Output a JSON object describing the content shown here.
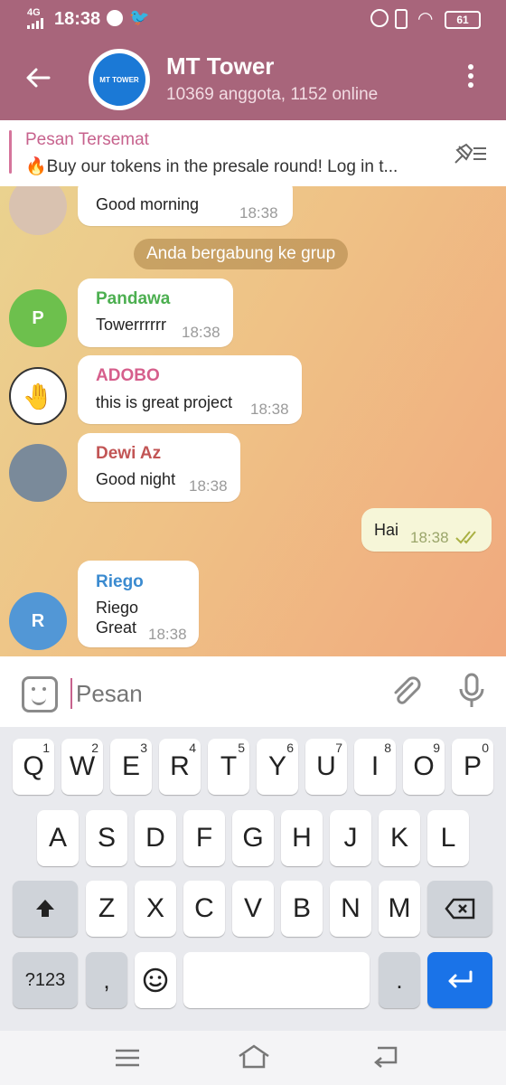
{
  "status": {
    "network": "4G",
    "time": "18:38",
    "battery": "61"
  },
  "header": {
    "title": "MT Tower",
    "subtitle": "10369 anggota, 1152 online",
    "avatar_text": "MT TOWER"
  },
  "pinned": {
    "label": "Pesan Tersemat",
    "text": "🔥Buy our tokens in the presale round! Log in t..."
  },
  "messages": [
    {
      "name": "",
      "text": "Good morning",
      "time": "18:38",
      "name_color": "#c7628d"
    },
    {
      "name": "Pandawa",
      "text": "Towerrrrrr",
      "time": "18:38",
      "name_color": "#4caf50",
      "avatar_letter": "P",
      "avatar_color": "#6dc04d"
    },
    {
      "name": "ADOBO",
      "text": "this is great project",
      "time": "18:38",
      "name_color": "#d65f8c"
    },
    {
      "name": "Dewi Az",
      "text": "Good night",
      "time": "18:38",
      "name_color": "#c25555"
    },
    {
      "name": "",
      "text": "Hai",
      "time": "18:38"
    },
    {
      "name": "Riego",
      "text_line1": "Riego",
      "text_line2": "Great",
      "time": "18:38",
      "name_color": "#3b8bd0",
      "avatar_letter": "R",
      "avatar_color": "#5297d6"
    }
  ],
  "service_message": "Anda bergabung ke grup",
  "input": {
    "placeholder": "Pesan"
  },
  "keyboard": {
    "row1": [
      {
        "k": "Q",
        "n": "1"
      },
      {
        "k": "W",
        "n": "2"
      },
      {
        "k": "E",
        "n": "3"
      },
      {
        "k": "R",
        "n": "4"
      },
      {
        "k": "T",
        "n": "5"
      },
      {
        "k": "Y",
        "n": "6"
      },
      {
        "k": "U",
        "n": "7"
      },
      {
        "k": "I",
        "n": "8"
      },
      {
        "k": "O",
        "n": "9"
      },
      {
        "k": "P",
        "n": "0"
      }
    ],
    "row2": [
      "A",
      "S",
      "D",
      "F",
      "G",
      "H",
      "J",
      "K",
      "L"
    ],
    "row3": [
      "Z",
      "X",
      "C",
      "V",
      "B",
      "N",
      "M"
    ],
    "sym_label": "?123",
    "comma": ",",
    "period": "."
  },
  "colors": {
    "header": "#a8657b",
    "accent": "#c7628d",
    "enter": "#1a73e8"
  }
}
